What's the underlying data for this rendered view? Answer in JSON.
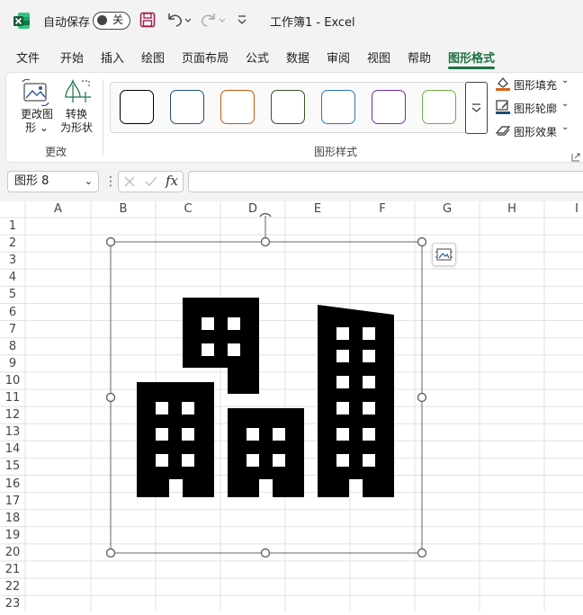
{
  "titlebar": {
    "autosave_label": "自动保存",
    "autosave_state": "关",
    "doc_title": "工作簿1  -  Excel"
  },
  "tabs": [
    {
      "label": "文件"
    },
    {
      "label": "开始"
    },
    {
      "label": "插入"
    },
    {
      "label": "绘图"
    },
    {
      "label": "页面布局"
    },
    {
      "label": "公式"
    },
    {
      "label": "数据"
    },
    {
      "label": "审阅"
    },
    {
      "label": "视图"
    },
    {
      "label": "帮助"
    },
    {
      "label": "图形格式",
      "active": true
    }
  ],
  "ribbon": {
    "change_shape": {
      "line1": "更改图",
      "line2": "形 ⌄"
    },
    "convert_shape": {
      "line1": "转换",
      "line2": "为形状"
    },
    "group_change": "更改",
    "group_styles": "图形样式",
    "style_colors": [
      "#000000",
      "#1f4e79",
      "#c55a11",
      "#375623",
      "#2e75b6",
      "#7030a0",
      "#70ad47"
    ],
    "fill": "图形填充",
    "outline": "图形轮廓",
    "effects": "图形效果"
  },
  "formula_bar": {
    "name_box": "图形 8",
    "fx": "fx",
    "formula_value": ""
  },
  "columns": [
    "A",
    "B",
    "C",
    "D",
    "E",
    "F",
    "G",
    "H",
    "I"
  ],
  "rows": [
    "1",
    "2",
    "3",
    "4",
    "5",
    "6",
    "7",
    "8",
    "9",
    "10",
    "11",
    "12",
    "13",
    "14",
    "15",
    "16",
    "17",
    "18",
    "19",
    "20",
    "21",
    "22",
    "23"
  ],
  "colors": {
    "accent": "#1e7145",
    "gridline": "#e1e1e1",
    "header_text": "#444444"
  }
}
